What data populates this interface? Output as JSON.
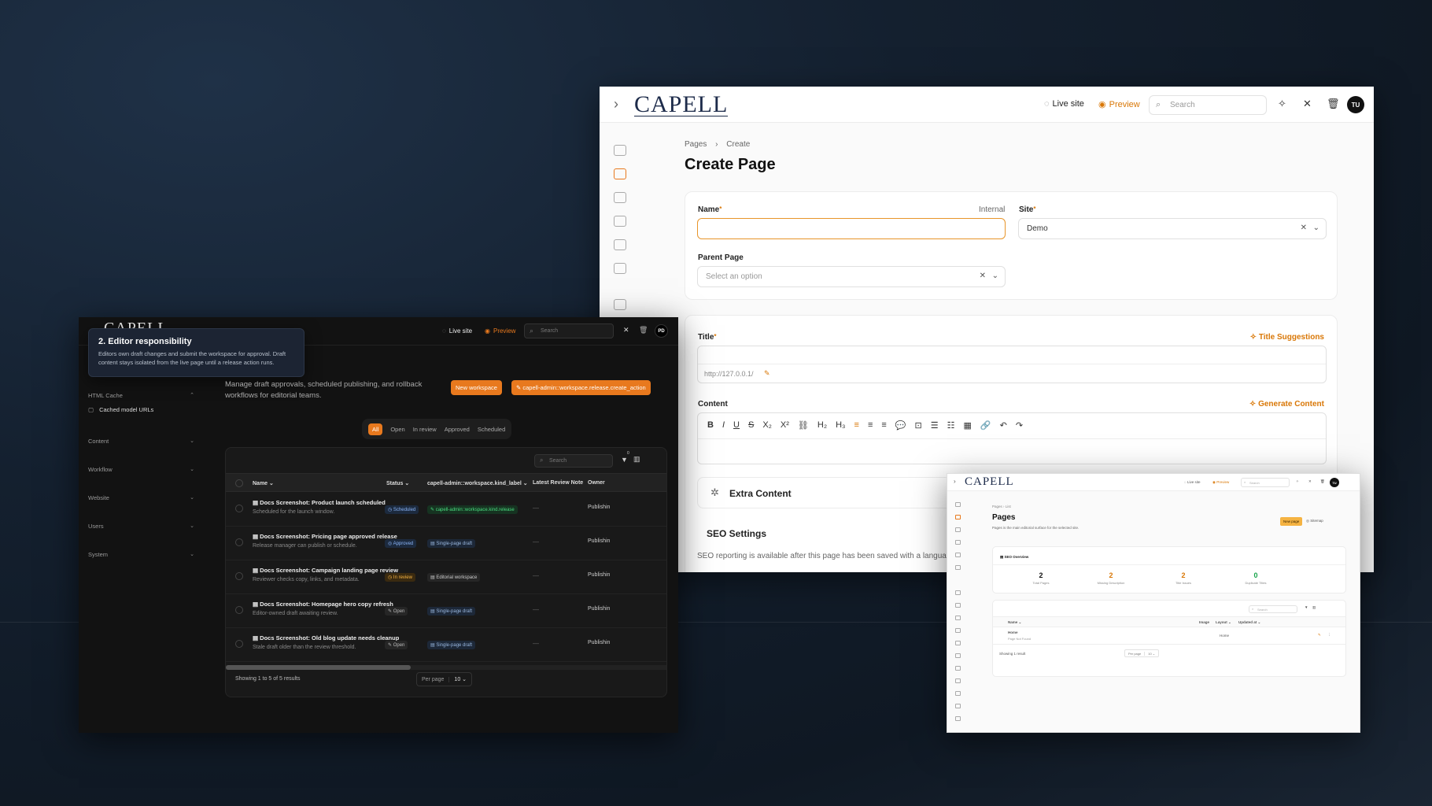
{
  "create_window": {
    "logo": "CAPELL",
    "live_site": "Live site",
    "preview": "Preview",
    "search_placeholder": "Search",
    "avatar": "TU",
    "breadcrumb": [
      "Pages",
      "Create"
    ],
    "title": "Create Page",
    "name_label": "Name",
    "name_hint": "Internal",
    "site_label": "Site",
    "site_value": "Demo",
    "parent_label": "Parent Page",
    "parent_placeholder": "Select an option",
    "title_label": "Title",
    "title_suggestions": "Title Suggestions",
    "url_prefix": "http://127.0.0.1/",
    "content_label": "Content",
    "generate_content": "Generate Content",
    "extra_content": "Extra Content",
    "seo_settings": "SEO Settings",
    "seo_note": "SEO reporting is available after this page has been saved with a langua",
    "toolbar": [
      "B",
      "I",
      "U",
      "S",
      "X₂",
      "X²",
      "⛓",
      "H₂",
      "H₃",
      "≡",
      "≡",
      "≡",
      "💬",
      "⊡",
      "☰",
      "☷",
      "▦",
      "🔗",
      "↶",
      "↷"
    ]
  },
  "workspace_window": {
    "logo": "CAPELL",
    "live_site": "Live site",
    "preview": "Preview",
    "search_placeholder": "Search",
    "avatar": "PD",
    "tooltip_title": "2. Editor responsibility",
    "tooltip_desc": "Editors own draft changes and submit the workspace for approval. Draft content stays isolated from the live page until a release action runs.",
    "sidebar": [
      {
        "label": "HTML Cache",
        "open": true
      },
      {
        "label": "Content"
      },
      {
        "label": "Workflow"
      },
      {
        "label": "Website"
      },
      {
        "label": "Users"
      },
      {
        "label": "System"
      }
    ],
    "cached_urls": "Cached model URLs",
    "description": "Manage draft approvals, scheduled publishing, and rollback workflows for editorial teams.",
    "new_workspace": "New workspace",
    "release_action": "capell-admin::workspace.release.create_action",
    "filters": [
      "All",
      "Open",
      "In review",
      "Approved",
      "Scheduled"
    ],
    "table_search": "Search",
    "filter_count": "0",
    "columns": [
      "Name",
      "Status",
      "capell-admin::workspace.kind_label",
      "Latest Review Note",
      "Owner"
    ],
    "rows": [
      {
        "name": "Docs Screenshot: Product launch scheduled",
        "sub": "Scheduled for the launch window.",
        "status": "Scheduled",
        "kind": "capell-admin::workspace.kind.release",
        "note": "—",
        "owner": "Publishin"
      },
      {
        "name": "Docs Screenshot: Pricing page approved release",
        "sub": "Release manager can publish or schedule.",
        "status": "Approved",
        "kind": "Single-page draft",
        "note": "—",
        "owner": "Publishin"
      },
      {
        "name": "Docs Screenshot: Campaign landing page review",
        "sub": "Reviewer checks copy, links, and metadata.",
        "status": "In review",
        "kind": "Editorial workspace",
        "note": "—",
        "owner": "Publishin"
      },
      {
        "name": "Docs Screenshot: Homepage hero copy refresh",
        "sub": "Editor-owned draft awaiting review.",
        "status": "Open",
        "kind": "Single-page draft",
        "note": "—",
        "owner": "Publishin"
      },
      {
        "name": "Docs Screenshot: Old blog update needs cleanup",
        "sub": "Stale draft older than the review threshold.",
        "status": "Open",
        "kind": "Single-page draft",
        "note": "—",
        "owner": "Publishin"
      }
    ],
    "showing": "Showing 1 to 5 of 5 results",
    "per_page_label": "Per page",
    "per_page_value": "10"
  },
  "pages_window": {
    "logo": "CAPELL",
    "live_site": "Live site",
    "preview": "Preview",
    "search_placeholder": "Search",
    "breadcrumb": [
      "Pages",
      "List"
    ],
    "title": "Pages",
    "subtitle": "Pages is the main editorial surface for the selected site.",
    "new_page": "New page",
    "sitemap": "Sitemap",
    "seo_overview": "SEO Overview",
    "stats": [
      {
        "value": "2",
        "label": "Total Pages",
        "color": "#111111"
      },
      {
        "value": "2",
        "label": "Missing Description",
        "color": "#d97706"
      },
      {
        "value": "2",
        "label": "Title Issues",
        "color": "#d97706"
      },
      {
        "value": "0",
        "label": "Duplicate Titles",
        "color": "#16a34a"
      }
    ],
    "columns": [
      "Name",
      "Image",
      "Layout",
      "Updated at"
    ],
    "row": {
      "name": "Home",
      "sub": "Page Not Found",
      "layout": "Home"
    },
    "showing": "Showing 1 result",
    "per_page_label": "Per page",
    "per_page_value": "10"
  },
  "colors": {
    "accent": "#e8791e",
    "brand": "#1d2b4a"
  }
}
